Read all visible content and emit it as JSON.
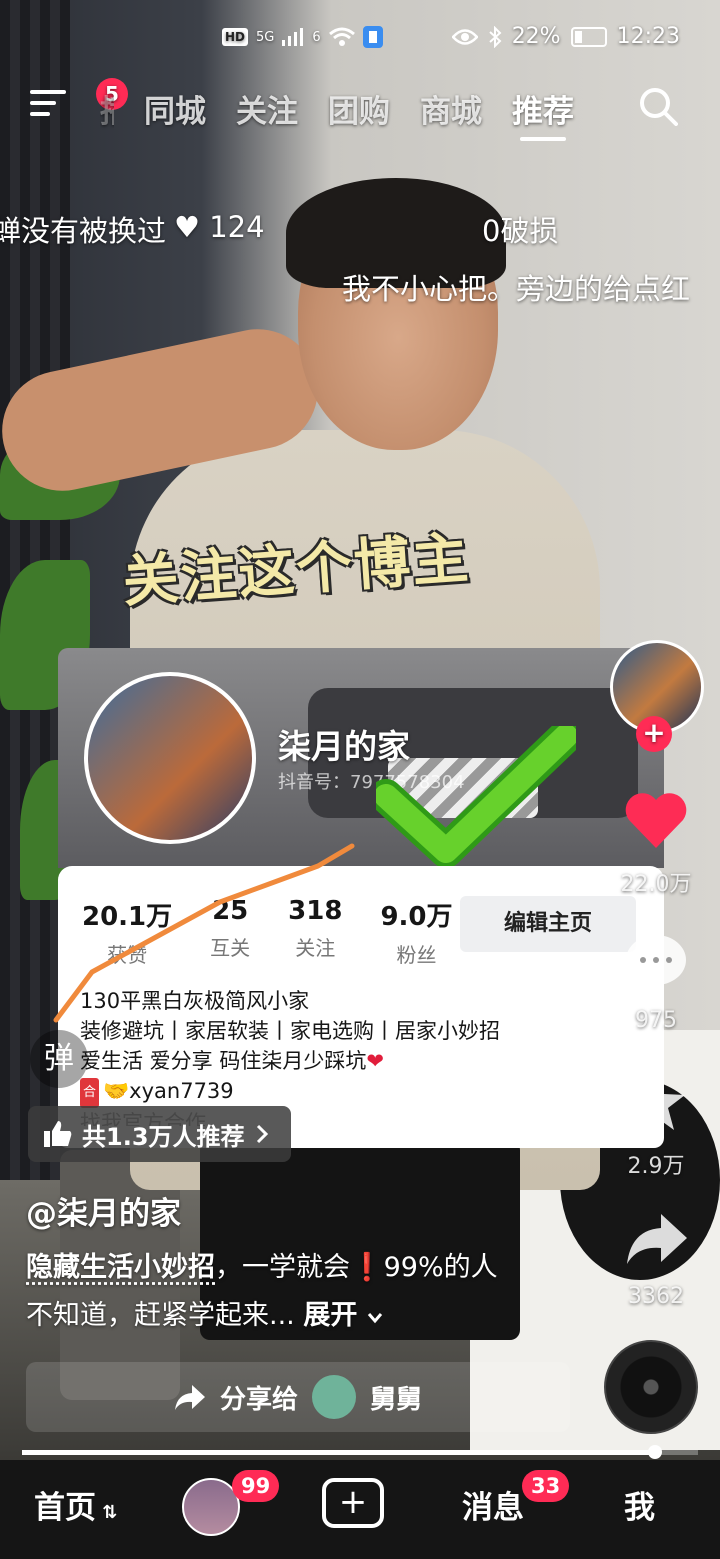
{
  "status_bar": {
    "hd": "HD",
    "network": "5G",
    "network2": "6",
    "battery": "22%",
    "time": "12:23"
  },
  "top_nav": {
    "menu_badge": "5",
    "partial_tab": "播",
    "tabs": [
      "同城",
      "关注",
      "团购",
      "商城",
      "推荐"
    ],
    "active_tab": "推荐"
  },
  "danmaku": [
    {
      "text": "蝉没有被换过"
    },
    {
      "text": "♥ 124"
    },
    {
      "text": "0破损"
    },
    {
      "text": "我不小心把。旁边的给点红"
    }
  ],
  "video_caption": "关注这个博主",
  "profile_card": {
    "name": "柒月的家",
    "douyin_id": "抖音号：7977578304",
    "stats": [
      {
        "num": "20.1万",
        "label": "获赞"
      },
      {
        "num": "25",
        "label": "互关"
      },
      {
        "num": "318",
        "label": "关注"
      },
      {
        "num": "9.0万",
        "label": "粉丝"
      }
    ],
    "edit_button": "编辑主页",
    "bio": [
      "130平黑白灰极简风小家",
      "装修避坑丨家居软装丨家电选购丨居家小妙招",
      "爱生活 爱分享 码住柒月少踩坑"
    ],
    "contact_tag": "合",
    "contact": "xyan7739",
    "cut_line": "找我官方合作"
  },
  "right_rail": {
    "like_count": "22.0万",
    "comment_count": "975",
    "favorite_count": "2.9万",
    "share_count": "3362"
  },
  "danmu_button": "弹",
  "recommend_pill": "共1.3万人推荐",
  "author": "@柒月的家",
  "description": {
    "highlight": "隐藏生活小妙招",
    "text1": "，一学就会",
    "excl": "❗",
    "text2": "99%的人不知道，赶紧学起来...",
    "more": "展开"
  },
  "share_bar": {
    "label": "分享给",
    "friend": "舅舅"
  },
  "bottom_nav": {
    "home": "首页",
    "friends_badge": "99",
    "messages": "消息",
    "messages_badge": "33",
    "me": "我"
  },
  "colors": {
    "accent": "#ff2b55",
    "nav_bg": "#151515"
  }
}
